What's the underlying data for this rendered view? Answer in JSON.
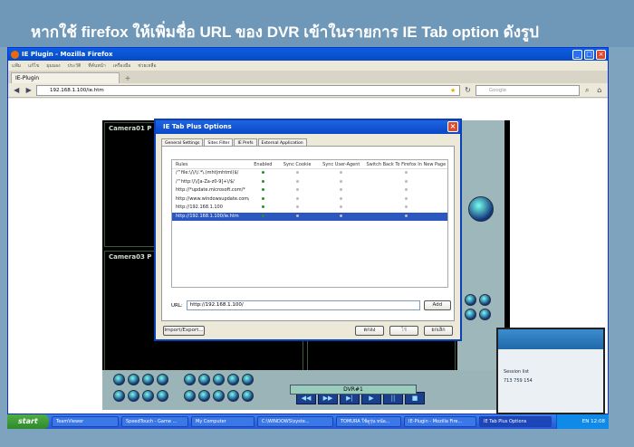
{
  "banner": {
    "title": "หากใช้ firefox ให้เพิ่มชื่อ URL ของ DVR เข้าในรายการ IE Tab option ดังรูป"
  },
  "firefox": {
    "window_title": "IE Plugin - Mozilla Firefox",
    "menu": [
      "แฟ้ม",
      "แก้ไข",
      "มุมมอง",
      "ประวัติ",
      "ที่คั่นหน้า",
      "เครื่องมือ",
      "ช่วยเหลือ"
    ],
    "tab_label": "IE-Plugin",
    "url": "192.168.1.100/ie.htm",
    "search_placeholder": "Google"
  },
  "dvr": {
    "camera1": "Camera01 P",
    "camera3": "Camera03 P",
    "label": "DVR#1"
  },
  "dialog": {
    "title": "IE Tab Plus Options",
    "tabs": [
      "General Settings",
      "Sites Filter",
      "IE Prefs",
      "External Application"
    ],
    "columns": [
      "Rules",
      "Enabled",
      "Sync Cookie",
      "Sync User-Agent",
      "Switch Back To Firefox In New Page"
    ],
    "rules": [
      "/^file:\\/\\/\\/.*\\.(mht|mhtml)$/",
      "/^http:\\/\\/[a-Za-z0-9]+\\/$/",
      "http://*update.microsoft.com/*",
      "http://www.windowsupdate.com/*",
      "http://192.168.1.100",
      "http://192.168.1.100/ie.htm"
    ],
    "url_label": "URL:",
    "url_value": "http://192.168.1.100/",
    "add_button": "Add",
    "import_button": "Import/Export...",
    "ok_button": "ตกลง",
    "apply_button": "ใช้",
    "cancel_button": "ยกเลิก"
  },
  "teamviewer": {
    "session": "Session list",
    "id": "713 759 154"
  },
  "taskbar": {
    "start": "start",
    "tasks": [
      "TeamViewer",
      "SpeedTouch - Game ...",
      "My Computer",
      "C:\\WINDOWS\\syste...",
      "TOMURA ใช้ดูรุ่น หน้อ...",
      "IE-Plugin - Mozilla Fire...",
      "IE Tab Plus Options"
    ],
    "lang": "EN",
    "clock": "12:08"
  }
}
